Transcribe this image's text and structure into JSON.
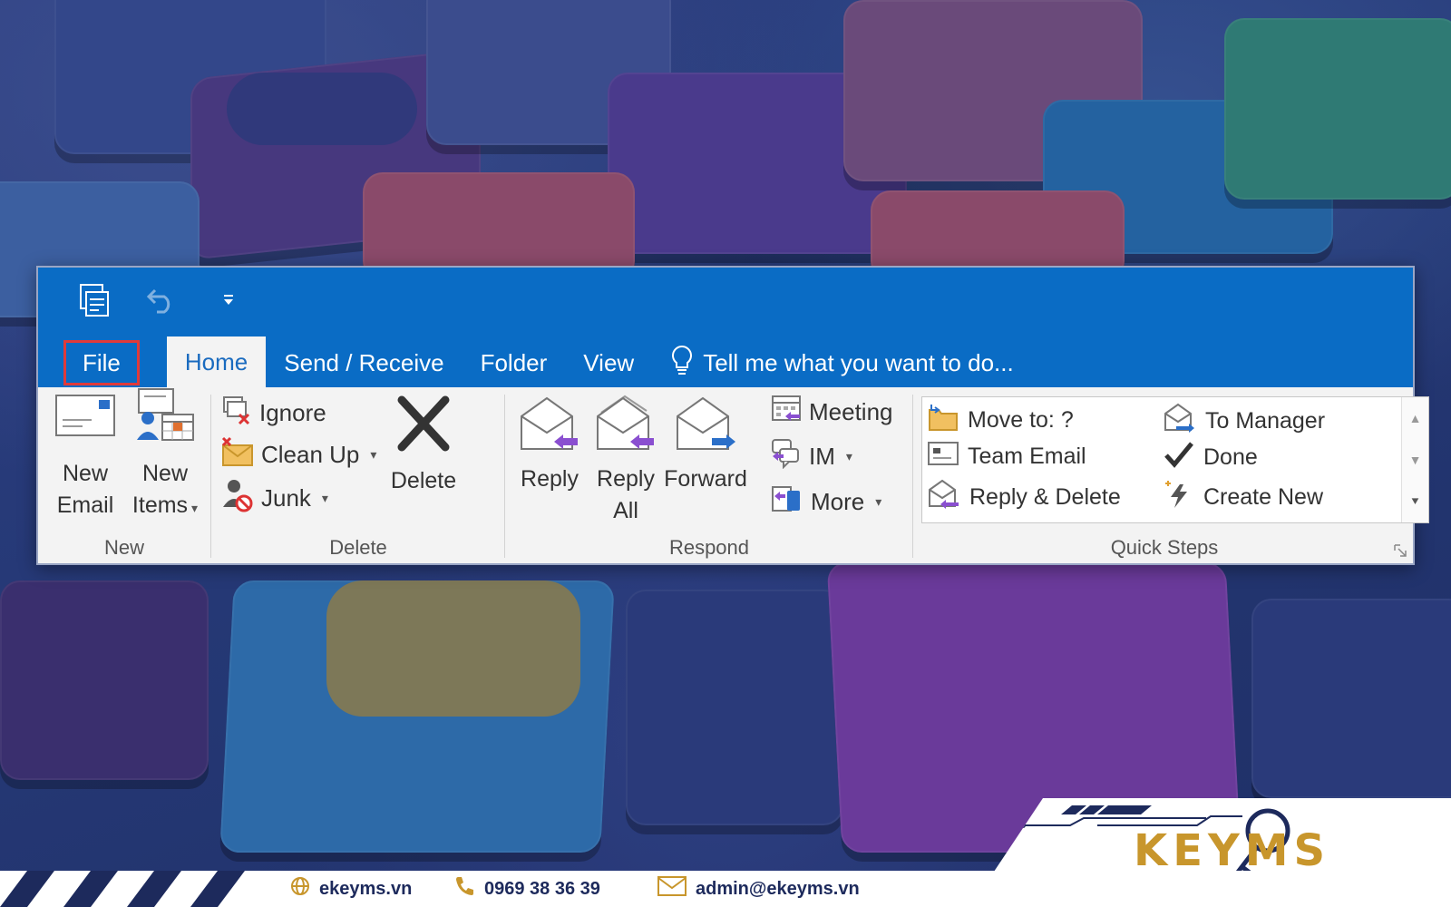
{
  "colors": {
    "title_bar": "#0a6cc5",
    "ribbon_bg": "#f3f3f3",
    "file_highlight": "#e03a3a",
    "brand_navy": "#1d2a5c",
    "brand_gold": "#c8962c",
    "arrow_purple": "#8a4fd0",
    "arrow_blue": "#2b6fc8"
  },
  "qat": {
    "icons": [
      "send-receive-all-folders-icon",
      "undo-icon",
      "customize-qat-icon"
    ]
  },
  "tabs": {
    "file": "File",
    "home": "Home",
    "send_receive": "Send / Receive",
    "folder": "Folder",
    "view": "View",
    "tell_me": "Tell me what you want to do..."
  },
  "groups": {
    "new": {
      "label": "New",
      "new_email": [
        "New",
        "Email"
      ],
      "new_items": [
        "New",
        "Items"
      ]
    },
    "delete": {
      "label": "Delete",
      "ignore": "Ignore",
      "clean_up": "Clean Up",
      "junk": "Junk",
      "delete": "Delete"
    },
    "respond": {
      "label": "Respond",
      "reply": "Reply",
      "reply_all": [
        "Reply",
        "All"
      ],
      "forward": "Forward",
      "meeting": "Meeting",
      "im": "IM",
      "more": "More"
    },
    "quick_steps": {
      "label": "Quick Steps",
      "move_to": "Move to: ?",
      "team_email": "Team Email",
      "reply_delete": "Reply & Delete",
      "to_manager": "To Manager",
      "done": "Done",
      "create_new": "Create New"
    }
  },
  "footer": {
    "website": "ekeyms.vn",
    "phone": "0969 38 36 39",
    "email": "admin@ekeyms.vn",
    "brand": "KEYMS"
  }
}
